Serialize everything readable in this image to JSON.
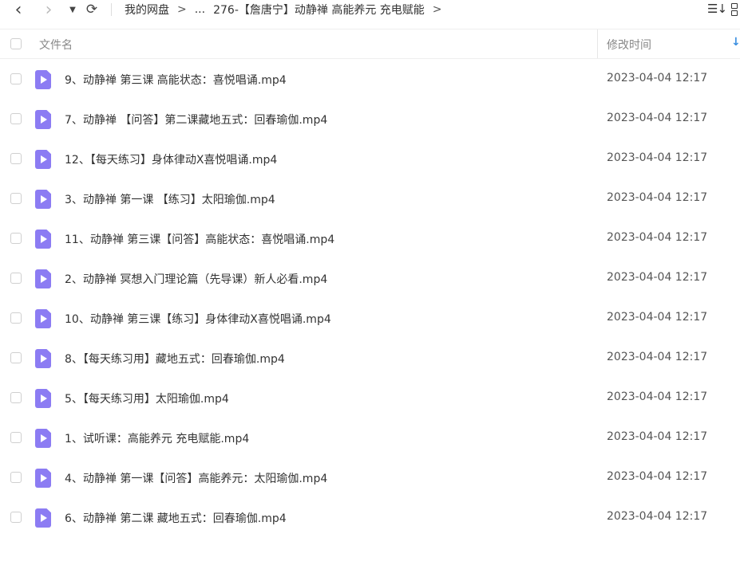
{
  "toolbar": {
    "back_icon": "‹",
    "forward_icon": "›",
    "dropdown_icon": "▼",
    "refresh_icon": "⟳",
    "breadcrumb": [
      {
        "label": "我的网盘"
      },
      {
        "label": ">"
      },
      {
        "label": "..."
      },
      {
        "label": "276-【詹唐宁】动静禅 高能养元 充电赋能"
      },
      {
        "label": ">"
      }
    ],
    "sort_icon": "☰↓"
  },
  "header": {
    "name_label": "文件名",
    "time_label": "修改时间",
    "sort_arrow": "↓"
  },
  "colors": {
    "file_icon": "#8c7cf3",
    "sort_arrow": "#3b8fe0"
  },
  "files": [
    {
      "name": "9、动静禅 第三课 高能状态：喜悦唱诵.mp4",
      "time": "2023-04-04 12:17",
      "icon": "video-file-icon"
    },
    {
      "name": "7、动静禅 【问答】第二课藏地五式：回春瑜伽.mp4",
      "time": "2023-04-04 12:17",
      "icon": "video-file-icon"
    },
    {
      "name": "12、【每天练习】身体律动X喜悦唱诵.mp4",
      "time": "2023-04-04 12:17",
      "icon": "video-file-icon"
    },
    {
      "name": "3、动静禅 第一课 【练习】太阳瑜伽.mp4",
      "time": "2023-04-04 12:17",
      "icon": "video-file-icon"
    },
    {
      "name": "11、动静禅 第三课【问答】高能状态：喜悦唱诵.mp4",
      "time": "2023-04-04 12:17",
      "icon": "video-file-icon"
    },
    {
      "name": "2、动静禅 冥想入门理论篇（先导课）新人必看.mp4",
      "time": "2023-04-04 12:17",
      "icon": "video-file-icon"
    },
    {
      "name": "10、动静禅 第三课【练习】身体律动X喜悦唱诵.mp4",
      "time": "2023-04-04 12:17",
      "icon": "video-file-icon"
    },
    {
      "name": "8、【每天练习用】藏地五式：回春瑜伽.mp4",
      "time": "2023-04-04 12:17",
      "icon": "video-file-icon"
    },
    {
      "name": "5、【每天练习用】太阳瑜伽.mp4",
      "time": "2023-04-04 12:17",
      "icon": "video-file-icon"
    },
    {
      "name": "1、试听课：高能养元 充电赋能.mp4",
      "time": "2023-04-04 12:17",
      "icon": "video-file-icon"
    },
    {
      "name": "4、动静禅 第一课【问答】高能养元：太阳瑜伽.mp4",
      "time": "2023-04-04 12:17",
      "icon": "video-file-icon"
    },
    {
      "name": "6、动静禅 第二课 藏地五式：回春瑜伽.mp4",
      "time": "2023-04-04 12:17",
      "icon": "video-file-icon"
    }
  ]
}
